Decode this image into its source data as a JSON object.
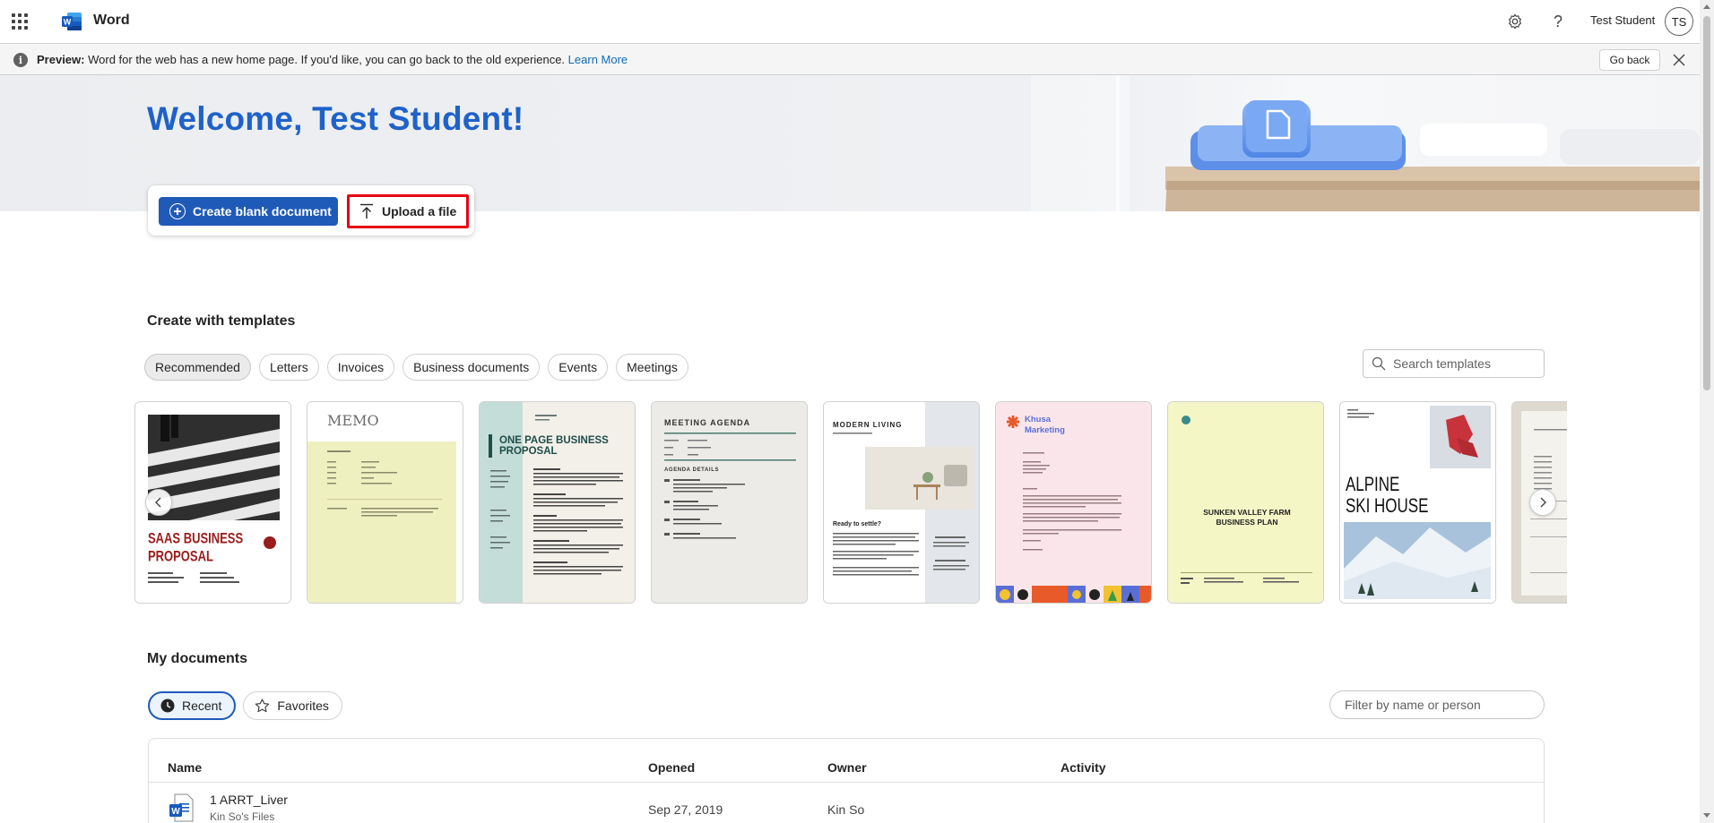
{
  "app": {
    "title": "Word",
    "user_name": "Test Student",
    "user_initials": "TS",
    "accent": "#1f5ab8"
  },
  "icons": {
    "waffle": "app-launcher-icon",
    "logo": "word-logo-icon",
    "settings": "gear-icon",
    "help": "question-icon",
    "info": "info-icon",
    "close": "close-icon",
    "upload": "upload-icon",
    "search": "search-icon",
    "clock": "clock-icon",
    "star": "star-icon"
  },
  "banner": {
    "label": "Preview:",
    "text": " Word for the web has a new home page. If you'd like, you can go back to the old experience. ",
    "link": "Learn More",
    "go_back": "Go back"
  },
  "hero": {
    "welcome": "Welcome, Test Student!",
    "create_blank": "Create blank document",
    "upload": "Upload a file"
  },
  "templates": {
    "heading": "Create with templates",
    "categories": [
      "Recommended",
      "Letters",
      "Invoices",
      "Business documents",
      "Events",
      "Meetings"
    ],
    "search_placeholder": "Search templates",
    "cards": {
      "saas": {
        "title1": "SAAS BUSINESS",
        "title2": "PROPOSAL"
      },
      "memo": {
        "title": "MEMO"
      },
      "one_page": {
        "title1": "ONE PAGE BUSINESS",
        "title2": "PROPOSAL"
      },
      "meeting": {
        "title": "MEETING AGENDA",
        "subtitle": "AGENDA DETAILS"
      },
      "modern": {
        "title": "MODERN LIVING",
        "subtitle": "Ready to settle?"
      },
      "khusa": {
        "title1": "Khusa",
        "title2": "Marketing"
      },
      "sunken": {
        "title1": "SUNKEN VALLEY FARM",
        "title2": "BUSINESS PLAN"
      },
      "alpine": {
        "title1": "ALPINE",
        "title2": "SKI HOUSE"
      }
    }
  },
  "documents": {
    "heading": "My documents",
    "tabs": [
      "Recent",
      "Favorites"
    ],
    "filter_placeholder": "Filter by name or person",
    "columns": [
      "Name",
      "Opened",
      "Owner",
      "Activity"
    ],
    "rows": [
      {
        "name": "1 ARRT_Liver",
        "location": "Kin So's Files",
        "opened": "Sep 27, 2019",
        "owner": "Kin So",
        "activity": ""
      }
    ]
  }
}
